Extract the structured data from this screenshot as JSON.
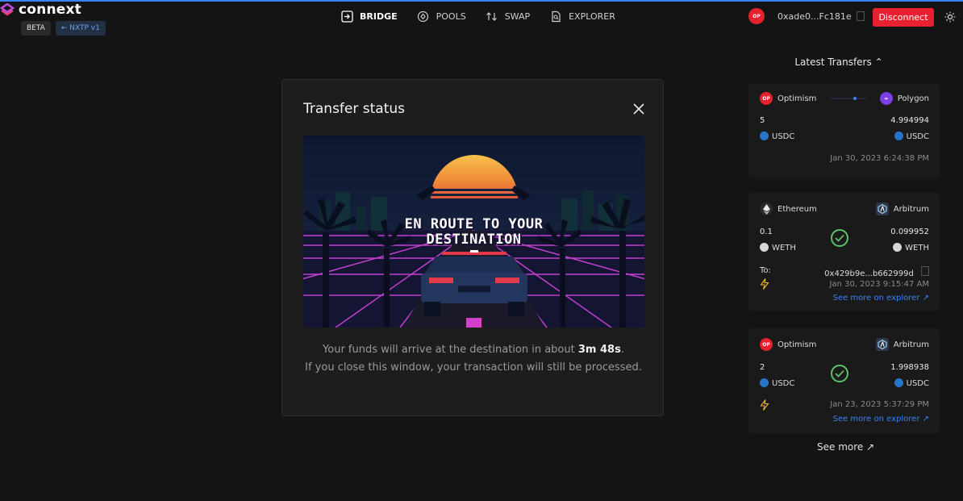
{
  "brand": {
    "name": "connext",
    "badge_beta": "BETA",
    "badge_version": "← NXTP v1"
  },
  "nav": [
    {
      "label": "BRIDGE",
      "icon": "bridge-icon"
    },
    {
      "label": "POOLS",
      "icon": "pools-icon"
    },
    {
      "label": "SWAP",
      "icon": "swap-icon"
    },
    {
      "label": "EXPLORER",
      "icon": "explorer-icon"
    }
  ],
  "wallet": {
    "network_badge": "OP",
    "address": "0xade0...Fc181e",
    "disconnect_label": "Disconnect"
  },
  "modal": {
    "title": "Transfer status",
    "art_text_line1": "EN ROUTE TO YOUR",
    "art_text_line2": "DESTINATION",
    "message_prefix": "Your funds will arrive at the destination in about",
    "eta": "3m 48s",
    "message_suffix": ".",
    "message_line2": "If you close this window, your transaction will still be processed."
  },
  "side": {
    "title": "Latest Transfers",
    "see_more": "See more ↗",
    "transfers": [
      {
        "from_chain": "Optimism",
        "to_chain": "Polygon",
        "from_amount": "5",
        "to_amount": "4.994994",
        "from_token": "USDC",
        "to_token": "USDC",
        "date": "Jan 30, 2023 6:24:38 PM"
      },
      {
        "from_chain": "Ethereum",
        "to_chain": "Arbitrum",
        "from_amount": "0.1",
        "to_amount": "0.099952",
        "from_token": "WETH",
        "to_token": "WETH",
        "to_label": "To:",
        "to_address": "0x429b9e...b662999d",
        "date": "Jan 30, 2023 9:15:47 AM",
        "explorer_link": "See more on explorer ↗"
      },
      {
        "from_chain": "Optimism",
        "to_chain": "Arbitrum",
        "from_amount": "2",
        "to_amount": "1.998938",
        "from_token": "USDC",
        "to_token": "USDC",
        "date": "Jan 23, 2023 5:37:29 PM",
        "explorer_link": "See more on explorer ↗"
      }
    ]
  },
  "colors": {
    "accent": "#3b82f6",
    "disconnect": "#e8202f",
    "success": "#5ec26a",
    "optimism": "#e5212d",
    "polygon": "#7b3fe4",
    "usdc": "#2775ca"
  }
}
